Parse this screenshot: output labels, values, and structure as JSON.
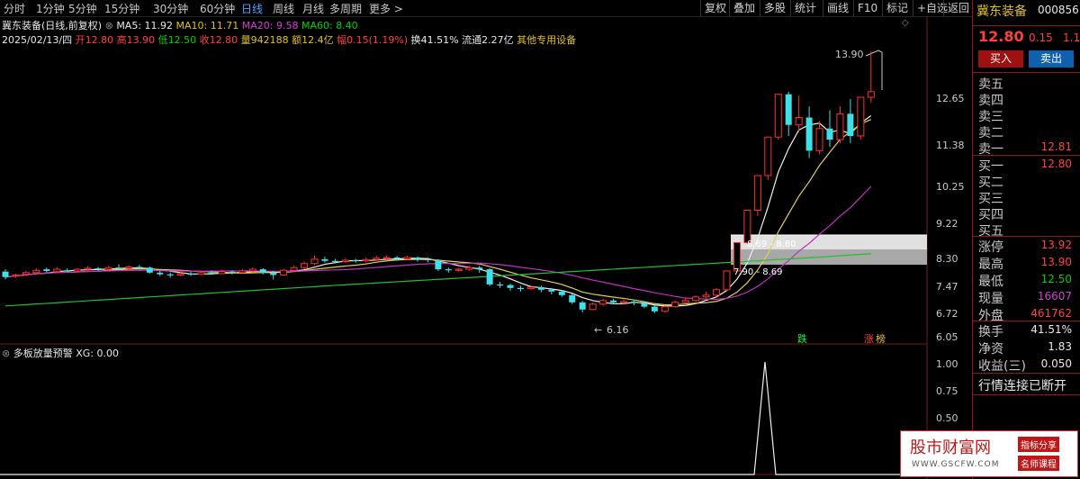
{
  "toolbar": {
    "periods": [
      "分时",
      "1分钟",
      "5分钟",
      "15分钟",
      "30分钟",
      "60分钟",
      "日线",
      "周线",
      "月线",
      "多周期",
      "更多 >"
    ],
    "active_period": "日线",
    "buttons": [
      "复权",
      "叠加",
      "多股",
      "统计",
      "画线",
      "F10",
      "标记",
      "+自选",
      "返回"
    ]
  },
  "header": {
    "stock": "冀东装备(日线,前复权)",
    "ma5": "MA5: 11.92",
    "ma10": "MA10: 11.71",
    "ma20": "MA20: 9.58",
    "ma60": "MA60: 8.40",
    "date": "2025/02/13/四",
    "open": "开12.80",
    "high": "高13.90",
    "low": "低12.50",
    "close": "收12.80",
    "volume": "量942188",
    "amount": "额12.4亿",
    "change": "幅0.15(1.19%)",
    "turnover": "换41.51%",
    "float": "流通2.27亿",
    "industry": "其他专用设备"
  },
  "price_axis": [
    "12.65",
    "11.38",
    "10.25",
    "9.22",
    "8.30",
    "7.47",
    "6.72",
    "6.05"
  ],
  "annotations": {
    "high_label": "13.90",
    "low_label": "6.16",
    "zone1": "8.69 - 8.80",
    "zone2": "7.90 - 8.69",
    "tag_down": "跌",
    "tag_up": "涨",
    "tag_bang": "榜"
  },
  "indicator": {
    "title": "多板放量预警",
    "xg": "XG: 0.00",
    "axis": [
      "1.00",
      "0.75",
      "0.50"
    ]
  },
  "chart_data": {
    "type": "candlestick",
    "candles_ohlc": [
      [
        7.88,
        7.72,
        7.95,
        7.65
      ],
      [
        7.75,
        7.78,
        7.82,
        7.7
      ],
      [
        7.8,
        7.85,
        7.9,
        7.75
      ],
      [
        7.85,
        7.92,
        7.98,
        7.8
      ],
      [
        7.95,
        7.9,
        8.0,
        7.85
      ],
      [
        7.88,
        7.95,
        8.02,
        7.84
      ],
      [
        7.92,
        7.9,
        7.98,
        7.86
      ],
      [
        7.9,
        7.95,
        7.99,
        7.85
      ],
      [
        7.95,
        7.98,
        8.05,
        7.9
      ],
      [
        7.98,
        7.95,
        8.02,
        7.9
      ],
      [
        7.95,
        8.0,
        8.05,
        7.92
      ],
      [
        8.0,
        7.98,
        8.1,
        7.94
      ],
      [
        7.98,
        8.02,
        8.06,
        7.93
      ],
      [
        8.02,
        8.0,
        8.08,
        7.95
      ],
      [
        8.0,
        7.85,
        8.03,
        7.82
      ],
      [
        7.85,
        7.8,
        7.9,
        7.75
      ],
      [
        7.8,
        7.78,
        7.85,
        7.7
      ],
      [
        7.78,
        7.82,
        7.88,
        7.74
      ],
      [
        7.82,
        7.8,
        7.88,
        7.76
      ],
      [
        7.8,
        7.85,
        7.9,
        7.78
      ],
      [
        7.85,
        7.82,
        7.92,
        7.78
      ],
      [
        7.82,
        7.88,
        7.94,
        7.8
      ],
      [
        7.88,
        7.85,
        7.92,
        7.8
      ],
      [
        7.85,
        7.9,
        7.96,
        7.82
      ],
      [
        7.9,
        7.95,
        8.0,
        7.86
      ],
      [
        7.95,
        7.85,
        7.98,
        7.8
      ],
      [
        7.85,
        7.78,
        7.9,
        7.65
      ],
      [
        7.78,
        7.92,
        7.96,
        7.76
      ],
      [
        7.92,
        8.0,
        8.06,
        7.88
      ],
      [
        8.0,
        8.12,
        8.18,
        7.95
      ],
      [
        8.12,
        8.25,
        8.35,
        8.08
      ],
      [
        8.25,
        8.2,
        8.32,
        8.15
      ],
      [
        8.2,
        8.18,
        8.26,
        8.12
      ],
      [
        8.18,
        8.22,
        8.28,
        8.14
      ],
      [
        8.22,
        8.2,
        8.26,
        8.15
      ],
      [
        8.2,
        8.24,
        8.3,
        8.16
      ],
      [
        8.24,
        8.28,
        8.34,
        8.2
      ],
      [
        8.28,
        8.3,
        8.36,
        8.22
      ],
      [
        8.3,
        8.26,
        8.34,
        8.2
      ],
      [
        8.26,
        8.3,
        8.35,
        8.22
      ],
      [
        8.3,
        8.25,
        8.33,
        8.18
      ],
      [
        8.25,
        8.22,
        8.3,
        8.16
      ],
      [
        8.22,
        7.95,
        8.25,
        7.9
      ],
      [
        7.95,
        7.92,
        8.0,
        7.85
      ],
      [
        7.92,
        7.95,
        8.0,
        7.88
      ],
      [
        7.95,
        8.0,
        8.06,
        7.9
      ],
      [
        8.0,
        7.95,
        8.05,
        7.85
      ],
      [
        7.95,
        7.5,
        7.98,
        7.45
      ],
      [
        7.5,
        7.48,
        7.58,
        7.4
      ],
      [
        7.48,
        7.4,
        7.52,
        7.32
      ],
      [
        7.4,
        7.38,
        7.46,
        7.3
      ],
      [
        7.38,
        7.42,
        7.48,
        7.34
      ],
      [
        7.42,
        7.35,
        7.46,
        7.28
      ],
      [
        7.35,
        7.3,
        7.4,
        7.22
      ],
      [
        7.3,
        7.2,
        7.34,
        7.15
      ],
      [
        7.2,
        7.0,
        7.24,
        6.95
      ],
      [
        7.0,
        6.8,
        7.04,
        6.72
      ],
      [
        6.8,
        6.95,
        7.0,
        6.78
      ],
      [
        6.95,
        7.05,
        7.1,
        6.9
      ],
      [
        7.05,
        7.0,
        7.1,
        6.95
      ],
      [
        7.0,
        7.02,
        7.08,
        6.95
      ],
      [
        7.02,
        6.98,
        7.06,
        6.92
      ],
      [
        6.98,
        6.88,
        7.02,
        6.84
      ],
      [
        6.88,
        6.75,
        6.92,
        6.7
      ],
      [
        6.75,
        6.88,
        6.92,
        6.72
      ],
      [
        6.88,
        7.0,
        7.05,
        6.85
      ],
      [
        7.0,
        7.05,
        7.12,
        6.98
      ],
      [
        7.05,
        7.15,
        7.2,
        7.02
      ],
      [
        7.15,
        7.2,
        7.3,
        7.1
      ],
      [
        7.2,
        7.35,
        7.4,
        7.15
      ],
      [
        7.35,
        7.9,
        7.9,
        7.3
      ],
      [
        7.9,
        8.69,
        8.69,
        7.88
      ],
      [
        8.69,
        9.56,
        9.56,
        8.65
      ],
      [
        9.56,
        10.52,
        10.52,
        9.4
      ],
      [
        10.52,
        11.57,
        11.57,
        10.4
      ],
      [
        11.57,
        12.73,
        12.73,
        11.5
      ],
      [
        12.73,
        11.9,
        12.8,
        11.6
      ],
      [
        11.9,
        12.1,
        12.7,
        11.7
      ],
      [
        12.1,
        11.2,
        12.4,
        11.0
      ],
      [
        11.2,
        11.8,
        12.0,
        11.1
      ],
      [
        11.8,
        11.5,
        12.3,
        11.3
      ],
      [
        11.5,
        12.2,
        12.4,
        11.4
      ],
      [
        12.2,
        11.6,
        12.6,
        11.4
      ],
      [
        11.6,
        12.65,
        12.65,
        11.5
      ],
      [
        12.65,
        12.8,
        13.9,
        12.5
      ]
    ]
  },
  "panel": {
    "name": "冀东装备",
    "code": "000856",
    "price": "12.80",
    "change": "0.15",
    "change_pct": "1.19",
    "buy_btn": "买入",
    "sell_btn": "卖出",
    "asks": [
      {
        "label": "卖五",
        "value": ""
      },
      {
        "label": "卖四",
        "value": ""
      },
      {
        "label": "卖三",
        "value": ""
      },
      {
        "label": "卖二",
        "value": ""
      },
      {
        "label": "卖一",
        "value": "12.81"
      }
    ],
    "bids": [
      {
        "label": "买一",
        "value": "12.80"
      },
      {
        "label": "买二",
        "value": ""
      },
      {
        "label": "买三",
        "value": ""
      },
      {
        "label": "买四",
        "value": ""
      },
      {
        "label": "买五",
        "value": ""
      }
    ],
    "stats1": [
      {
        "label": "涨停",
        "value": "13.92",
        "color": "#ff4040"
      },
      {
        "label": "最高",
        "value": "13.90",
        "color": "#ff4040"
      },
      {
        "label": "最低",
        "value": "12.50",
        "color": "#00d000"
      },
      {
        "label": "现量",
        "value": "16607",
        "color": "#d040d0"
      },
      {
        "label": "外盘",
        "value": "461762",
        "color": "#ff4040"
      }
    ],
    "stats2": [
      {
        "label": "换手",
        "value": "41.51%",
        "color": "#e8e8e8"
      },
      {
        "label": "净资",
        "value": "1.83",
        "color": "#e8e8e8"
      },
      {
        "label": "收益(三)",
        "value": "0.050",
        "color": "#e8e8e8"
      }
    ],
    "status": "行情连接已断开"
  },
  "watermark": {
    "title": "股市财富网",
    "url": "WWW.GSCFW.COM",
    "tag1": "指标分享",
    "tag2": "名师课程"
  }
}
